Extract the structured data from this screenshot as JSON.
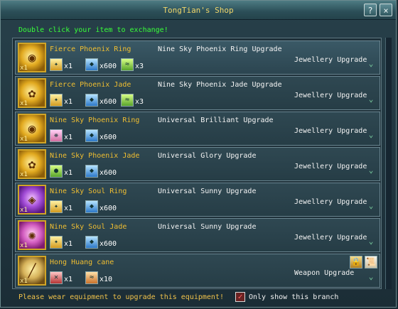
{
  "window": {
    "title": "TongTian's Shop",
    "help_label": "?",
    "close_label": "×"
  },
  "hint": "Double click your item to exchange!",
  "items": [
    {
      "name": "Fierce Phoenix Ring",
      "upgrade": "Nine Sky Phoenix Ring Upgrade",
      "branch": "Jewellery Upgrade",
      "item_qty": "x1",
      "materials": [
        {
          "qty": "x1",
          "icon": "gold"
        },
        {
          "qty": "x600",
          "icon": "blue"
        },
        {
          "qty": "x3",
          "icon": "green"
        }
      ],
      "icon": "gold"
    },
    {
      "name": "Fierce Phoenix Jade",
      "upgrade": "Nine Sky Phoenix Jade Upgrade",
      "branch": "Jewellery Upgrade",
      "item_qty": "x1",
      "materials": [
        {
          "qty": "x1",
          "icon": "gold"
        },
        {
          "qty": "x600",
          "icon": "blue"
        },
        {
          "qty": "x3",
          "icon": "green"
        }
      ],
      "icon": "gold"
    },
    {
      "name": "Nine Sky Phoenix Ring",
      "upgrade": "Universal Brilliant Upgrade",
      "branch": "Jewellery Upgrade",
      "item_qty": "x1",
      "materials": [
        {
          "qty": "x1",
          "icon": "pink"
        },
        {
          "qty": "x600",
          "icon": "blue"
        }
      ],
      "icon": "gold"
    },
    {
      "name": "Nine Sky Phoenix Jade",
      "upgrade": "Universal Glory Upgrade",
      "branch": "Jewellery Upgrade",
      "item_qty": "x1",
      "materials": [
        {
          "qty": "x1",
          "icon": "green"
        },
        {
          "qty": "x600",
          "icon": "blue"
        }
      ],
      "icon": "gold"
    },
    {
      "name": "Nine Sky Soul Ring",
      "upgrade": "Universal Sunny Upgrade",
      "branch": "Jewellery Upgrade",
      "item_qty": "x1",
      "materials": [
        {
          "qty": "x1",
          "icon": "gold"
        },
        {
          "qty": "x600",
          "icon": "blue"
        }
      ],
      "icon": "violet"
    },
    {
      "name": "Nine Sky Soul Jade",
      "upgrade": "Universal Sunny Upgrade",
      "branch": "Jewellery Upgrade",
      "item_qty": "x1",
      "materials": [
        {
          "qty": "x1",
          "icon": "gold"
        },
        {
          "qty": "x600",
          "icon": "blue"
        }
      ],
      "icon": "pink"
    },
    {
      "name": "Hong Huang cane",
      "upgrade": "",
      "branch": "Weapon Upgrade",
      "item_qty": "x1",
      "materials": [
        {
          "qty": "x1",
          "icon": "red"
        },
        {
          "qty": "x10",
          "icon": "orange"
        }
      ],
      "icon": "cane"
    }
  ],
  "footer": {
    "message": "Please wear equipment to upgrade this equipment!",
    "checkbox_label": "Only show this branch",
    "checkbox_checked": true
  }
}
